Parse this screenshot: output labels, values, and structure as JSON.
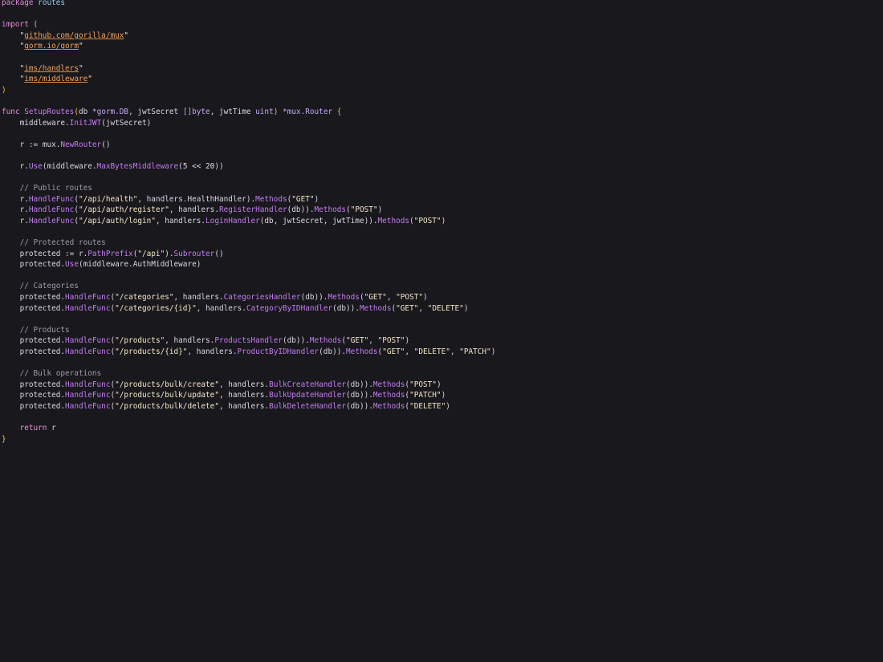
{
  "editor": {
    "theme": {
      "background": "#19181d",
      "keyword": "#e58bd6",
      "function": "#c47df2",
      "string": "#f4e8c8",
      "import_path": "#f2a45e",
      "bracket": "#f2c64e",
      "comment": "#9f9aa8",
      "text": "#dcd7e4"
    },
    "lines": [
      [
        [
          "kw",
          "package"
        ],
        [
          "plain",
          " "
        ],
        [
          "pkg",
          "routes"
        ]
      ],
      [],
      [
        [
          "kw",
          "import"
        ],
        [
          "plain",
          " "
        ],
        [
          "punc",
          "("
        ]
      ],
      [
        [
          "plain",
          "    "
        ],
        [
          "str",
          "\""
        ],
        [
          "imp",
          "github.com/gorilla/mux"
        ],
        [
          "str",
          "\""
        ]
      ],
      [
        [
          "plain",
          "    "
        ],
        [
          "str",
          "\""
        ],
        [
          "imp",
          "gorm.io/gorm"
        ],
        [
          "str",
          "\""
        ]
      ],
      [],
      [
        [
          "plain",
          "    "
        ],
        [
          "str",
          "\""
        ],
        [
          "imp",
          "ims/handlers"
        ],
        [
          "str",
          "\""
        ]
      ],
      [
        [
          "plain",
          "    "
        ],
        [
          "str",
          "\""
        ],
        [
          "imp",
          "ims/middleware"
        ],
        [
          "str",
          "\""
        ]
      ],
      [
        [
          "punc",
          ")"
        ]
      ],
      [],
      [
        [
          "kw",
          "func"
        ],
        [
          "plain",
          " "
        ],
        [
          "fn",
          "SetupRoutes"
        ],
        [
          "punc",
          "("
        ],
        [
          "plain",
          "db "
        ],
        [
          "type",
          "*gorm.DB"
        ],
        [
          "plain",
          ", jwtSecret "
        ],
        [
          "type",
          "[]byte"
        ],
        [
          "plain",
          ", jwtTime "
        ],
        [
          "type",
          "uint"
        ],
        [
          "punc",
          ")"
        ],
        [
          "plain",
          " "
        ],
        [
          "type",
          "*mux.Router"
        ],
        [
          "plain",
          " "
        ],
        [
          "punc",
          "{"
        ]
      ],
      [
        [
          "plain",
          "    middleware."
        ],
        [
          "fn",
          "InitJWT"
        ],
        [
          "plain",
          "(jwtSecret)"
        ]
      ],
      [],
      [
        [
          "plain",
          "    r := mux."
        ],
        [
          "fn",
          "NewRouter"
        ],
        [
          "plain",
          "()"
        ]
      ],
      [],
      [
        [
          "plain",
          "    r."
        ],
        [
          "fn",
          "Use"
        ],
        [
          "plain",
          "(middleware."
        ],
        [
          "fn",
          "MaxBytesMiddleware"
        ],
        [
          "plain",
          "("
        ],
        [
          "num",
          "5 << 20"
        ],
        [
          "plain",
          "))"
        ]
      ],
      [],
      [
        [
          "com",
          "    // Public routes"
        ]
      ],
      [
        [
          "plain",
          "    r."
        ],
        [
          "fn",
          "HandleFunc"
        ],
        [
          "plain",
          "("
        ],
        [
          "str",
          "\"/api/health\""
        ],
        [
          "plain",
          ", handlers.HealthHandler)."
        ],
        [
          "fn",
          "Methods"
        ],
        [
          "plain",
          "("
        ],
        [
          "str",
          "\"GET\""
        ],
        [
          "plain",
          ")"
        ]
      ],
      [
        [
          "plain",
          "    r."
        ],
        [
          "fn",
          "HandleFunc"
        ],
        [
          "plain",
          "("
        ],
        [
          "str",
          "\"/api/auth/register\""
        ],
        [
          "plain",
          ", handlers."
        ],
        [
          "fn",
          "RegisterHandler"
        ],
        [
          "plain",
          "(db))."
        ],
        [
          "fn",
          "Methods"
        ],
        [
          "plain",
          "("
        ],
        [
          "str",
          "\"POST\""
        ],
        [
          "plain",
          ")"
        ]
      ],
      [
        [
          "plain",
          "    r."
        ],
        [
          "fn",
          "HandleFunc"
        ],
        [
          "plain",
          "("
        ],
        [
          "str",
          "\"/api/auth/login\""
        ],
        [
          "plain",
          ", handlers."
        ],
        [
          "fn",
          "LoginHandler"
        ],
        [
          "plain",
          "(db, jwtSecret, jwtTime))."
        ],
        [
          "fn",
          "Methods"
        ],
        [
          "plain",
          "("
        ],
        [
          "str",
          "\"POST\""
        ],
        [
          "plain",
          ")"
        ]
      ],
      [],
      [
        [
          "com",
          "    // Protected routes"
        ]
      ],
      [
        [
          "plain",
          "    protected := r."
        ],
        [
          "fn",
          "PathPrefix"
        ],
        [
          "plain",
          "("
        ],
        [
          "str",
          "\"/api\""
        ],
        [
          "plain",
          ")."
        ],
        [
          "fn",
          "Subrouter"
        ],
        [
          "plain",
          "()"
        ]
      ],
      [
        [
          "plain",
          "    protected."
        ],
        [
          "fn",
          "Use"
        ],
        [
          "plain",
          "(middleware.AuthMiddleware)"
        ]
      ],
      [],
      [
        [
          "com",
          "    // Categories"
        ]
      ],
      [
        [
          "plain",
          "    protected."
        ],
        [
          "fn",
          "HandleFunc"
        ],
        [
          "plain",
          "("
        ],
        [
          "str",
          "\"/categories\""
        ],
        [
          "plain",
          ", handlers."
        ],
        [
          "fn",
          "CategoriesHandler"
        ],
        [
          "plain",
          "(db))."
        ],
        [
          "fn",
          "Methods"
        ],
        [
          "plain",
          "("
        ],
        [
          "str",
          "\"GET\""
        ],
        [
          "plain",
          ", "
        ],
        [
          "str",
          "\"POST\""
        ],
        [
          "plain",
          ")"
        ]
      ],
      [
        [
          "plain",
          "    protected."
        ],
        [
          "fn",
          "HandleFunc"
        ],
        [
          "plain",
          "("
        ],
        [
          "str",
          "\"/categories/{id}\""
        ],
        [
          "plain",
          ", handlers."
        ],
        [
          "fn",
          "CategoryByIDHandler"
        ],
        [
          "plain",
          "(db))."
        ],
        [
          "fn",
          "Methods"
        ],
        [
          "plain",
          "("
        ],
        [
          "str",
          "\"GET\""
        ],
        [
          "plain",
          ", "
        ],
        [
          "str",
          "\"DELETE\""
        ],
        [
          "plain",
          ")"
        ]
      ],
      [],
      [
        [
          "com",
          "    // Products"
        ]
      ],
      [
        [
          "plain",
          "    protected."
        ],
        [
          "fn",
          "HandleFunc"
        ],
        [
          "plain",
          "("
        ],
        [
          "str",
          "\"/products\""
        ],
        [
          "plain",
          ", handlers."
        ],
        [
          "fn",
          "ProductsHandler"
        ],
        [
          "plain",
          "(db))."
        ],
        [
          "fn",
          "Methods"
        ],
        [
          "plain",
          "("
        ],
        [
          "str",
          "\"GET\""
        ],
        [
          "plain",
          ", "
        ],
        [
          "str",
          "\"POST\""
        ],
        [
          "plain",
          ")"
        ]
      ],
      [
        [
          "plain",
          "    protected."
        ],
        [
          "fn",
          "HandleFunc"
        ],
        [
          "plain",
          "("
        ],
        [
          "str",
          "\"/products/{id}\""
        ],
        [
          "plain",
          ", handlers."
        ],
        [
          "fn",
          "ProductByIDHandler"
        ],
        [
          "plain",
          "(db))."
        ],
        [
          "fn",
          "Methods"
        ],
        [
          "plain",
          "("
        ],
        [
          "str",
          "\"GET\""
        ],
        [
          "plain",
          ", "
        ],
        [
          "str",
          "\"DELETE\""
        ],
        [
          "plain",
          ", "
        ],
        [
          "str",
          "\"PATCH\""
        ],
        [
          "plain",
          ")"
        ]
      ],
      [],
      [
        [
          "com",
          "    // Bulk operations"
        ]
      ],
      [
        [
          "plain",
          "    protected."
        ],
        [
          "fn",
          "HandleFunc"
        ],
        [
          "plain",
          "("
        ],
        [
          "str",
          "\"/products/bulk/create\""
        ],
        [
          "plain",
          ", handlers."
        ],
        [
          "fn",
          "BulkCreateHandler"
        ],
        [
          "plain",
          "(db))."
        ],
        [
          "fn",
          "Methods"
        ],
        [
          "plain",
          "("
        ],
        [
          "str",
          "\"POST\""
        ],
        [
          "plain",
          ")"
        ]
      ],
      [
        [
          "plain",
          "    protected."
        ],
        [
          "fn",
          "HandleFunc"
        ],
        [
          "plain",
          "("
        ],
        [
          "str",
          "\"/products/bulk/update\""
        ],
        [
          "plain",
          ", handlers."
        ],
        [
          "fn",
          "BulkUpdateHandler"
        ],
        [
          "plain",
          "(db))."
        ],
        [
          "fn",
          "Methods"
        ],
        [
          "plain",
          "("
        ],
        [
          "str",
          "\"PATCH\""
        ],
        [
          "plain",
          ")"
        ]
      ],
      [
        [
          "plain",
          "    protected."
        ],
        [
          "fn",
          "HandleFunc"
        ],
        [
          "plain",
          "("
        ],
        [
          "str",
          "\"/products/bulk/delete\""
        ],
        [
          "plain",
          ", handlers."
        ],
        [
          "fn",
          "BulkDeleteHandler"
        ],
        [
          "plain",
          "(db))."
        ],
        [
          "fn",
          "Methods"
        ],
        [
          "plain",
          "("
        ],
        [
          "str",
          "\"DELETE\""
        ],
        [
          "plain",
          ")"
        ]
      ],
      [],
      [
        [
          "plain",
          "    "
        ],
        [
          "ret",
          "return"
        ],
        [
          "plain",
          " r"
        ]
      ],
      [
        [
          "punc",
          "}"
        ]
      ]
    ]
  }
}
